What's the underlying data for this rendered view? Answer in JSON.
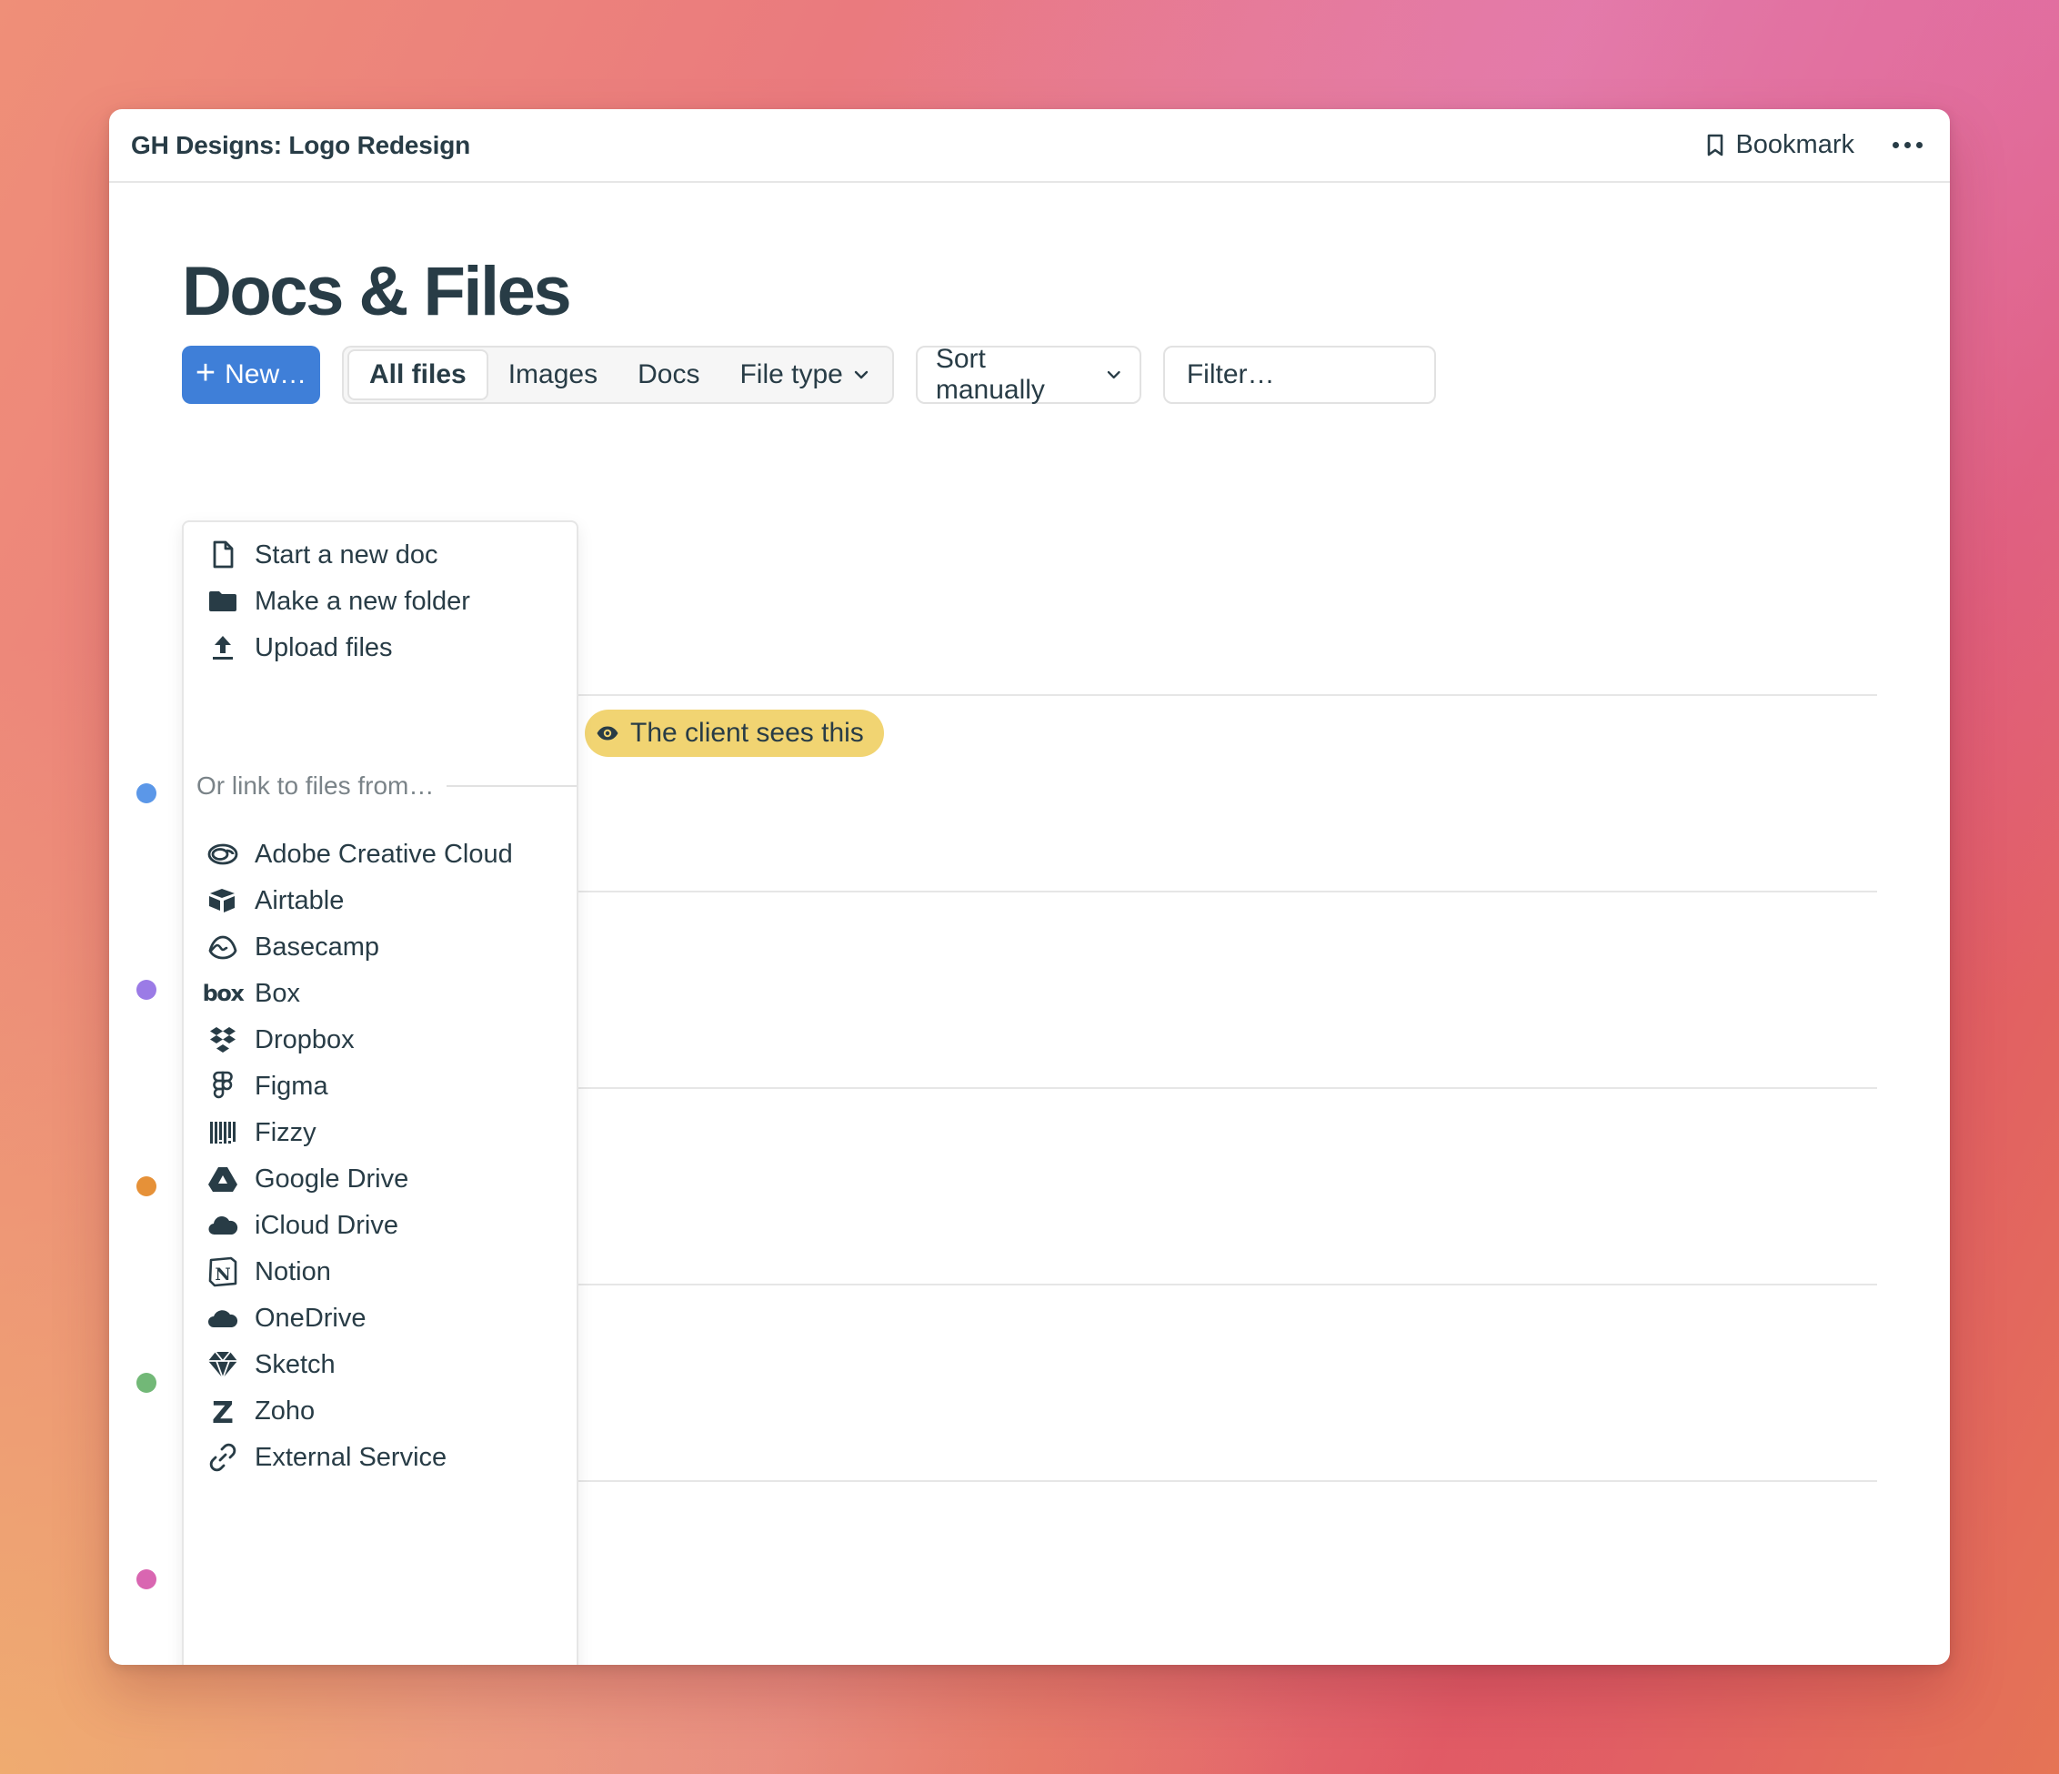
{
  "header": {
    "project_title": "GH Designs: Logo Redesign",
    "bookmark_label": "Bookmark"
  },
  "page": {
    "title": "Docs & Files"
  },
  "toolbar": {
    "new_label": "New…",
    "tabs": [
      {
        "label": "All files",
        "active": true
      },
      {
        "label": "Images",
        "active": false
      },
      {
        "label": "Docs",
        "active": false
      },
      {
        "label": "File type",
        "active": false
      }
    ],
    "sort_label": "Sort manually",
    "filter_placeholder": "Filter…"
  },
  "badge": {
    "label": "The client sees this",
    "color": "#f1d472"
  },
  "row_dots": [
    "#5b97e8",
    "#9b7be6",
    "#e69138",
    "#72b877",
    "#d966b1"
  ],
  "menu": {
    "primary": [
      {
        "label": "Start a new doc",
        "icon": "doc-icon"
      },
      {
        "label": "Make a new folder",
        "icon": "folder-icon"
      },
      {
        "label": "Upload files",
        "icon": "upload-icon"
      }
    ],
    "section_label": "Or link to files from…",
    "services": [
      {
        "label": "Adobe Creative Cloud",
        "icon": "adobe-cc-icon"
      },
      {
        "label": "Airtable",
        "icon": "airtable-icon"
      },
      {
        "label": "Basecamp",
        "icon": "basecamp-icon"
      },
      {
        "label": "Box",
        "icon": "box-icon",
        "glyph": "box"
      },
      {
        "label": "Dropbox",
        "icon": "dropbox-icon"
      },
      {
        "label": "Figma",
        "icon": "figma-icon"
      },
      {
        "label": "Fizzy",
        "icon": "fizzy-icon"
      },
      {
        "label": "Google Drive",
        "icon": "google-drive-icon"
      },
      {
        "label": "iCloud Drive",
        "icon": "icloud-icon"
      },
      {
        "label": "Notion",
        "icon": "notion-icon",
        "glyph": "N"
      },
      {
        "label": "OneDrive",
        "icon": "onedrive-icon"
      },
      {
        "label": "Sketch",
        "icon": "sketch-icon"
      },
      {
        "label": "Zoho",
        "icon": "zoho-icon",
        "glyph": "Z"
      },
      {
        "label": "External Service",
        "icon": "link-icon"
      }
    ]
  },
  "colors": {
    "accent": "#3f7fd8",
    "text": "#283c46"
  }
}
